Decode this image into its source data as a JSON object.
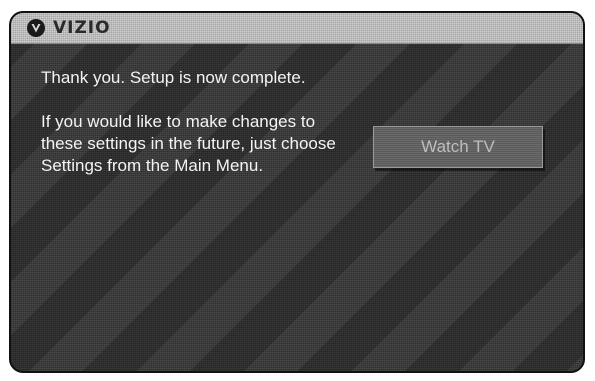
{
  "header": {
    "logo_icon": "vizio-v-logo-icon",
    "brand": "VIZIO"
  },
  "message": {
    "line1": "Thank you. Setup is now complete.",
    "line2": "If you would like to make changes to these settings in the future, just choose Settings from the Main Menu."
  },
  "actions": {
    "watch_tv_label": "Watch TV"
  },
  "colors": {
    "background": "#3a3a3a",
    "titlebar": "#cfcfcf",
    "text": "#f4f4f4",
    "button_text": "#bdbdbd"
  }
}
